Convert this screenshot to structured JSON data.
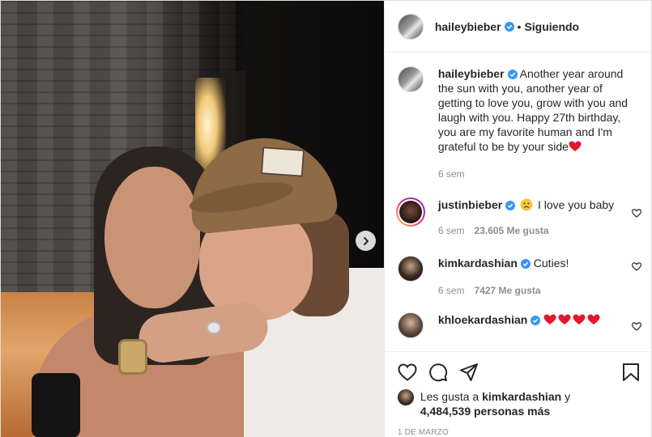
{
  "post": {
    "author": "haileybieber",
    "follow_status": "Siguiendo",
    "caption": "Another year around the sun with you, another year of getting to love you, grow with you and laugh with you. Happy 27th birthday, you are my favorite human and I'm grateful to be by your side",
    "caption_time": "6 sem"
  },
  "comments": [
    {
      "username": "justinbieber",
      "text_after": "I love you baby",
      "time": "6 sem",
      "likes": "23.605 Me gusta"
    },
    {
      "username": "kimkardashian",
      "text": "Cuties!",
      "time": "6 sem",
      "likes": "7427 Me gusta"
    },
    {
      "username": "khloekardashian"
    }
  ],
  "likes": {
    "prefix": "Les gusta a",
    "user": "kimkardashian",
    "connector": "y",
    "count": "4,484,539 personas más"
  },
  "date": "1 DE MARZO",
  "colors": {
    "verified": "#3897f0",
    "heart_red": "#ed4956",
    "meta_gray": "#8e8e8e"
  },
  "icons": [
    "chevron-right-icon",
    "verified-icon",
    "heart-outline-icon",
    "comment-icon",
    "share-icon",
    "bookmark-icon",
    "frown-emoji-icon",
    "red-heart-icon"
  ]
}
